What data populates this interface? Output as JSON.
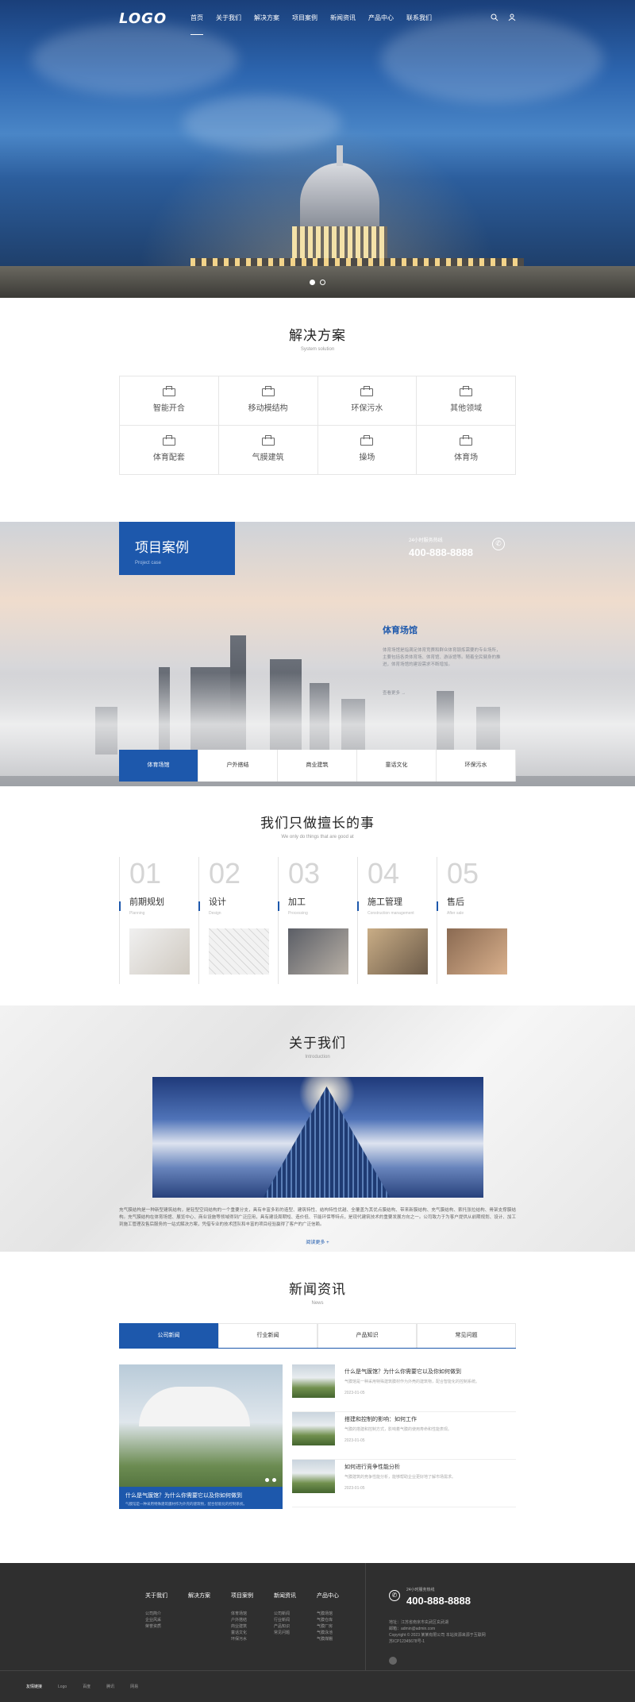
{
  "nav": {
    "logo": "LOGO",
    "items": [
      "首页",
      "关于我们",
      "解决方案",
      "项目案例",
      "新闻资讯",
      "产品中心",
      "联系我们"
    ],
    "icons": [
      "search-icon",
      "user-icon"
    ]
  },
  "solutions": {
    "title": "解决方案",
    "subtitle": "System solution",
    "items": [
      "智能开合",
      "移动模结构",
      "环保污水",
      "其他领域",
      "体育配套",
      "气膜建筑",
      "操场",
      "体育场"
    ]
  },
  "cases": {
    "badge_title": "项目案例",
    "badge_sub": "Project case",
    "hotline_label": "24小时服务热线",
    "hotline": "400-888-8888",
    "item_title": "体育场馆",
    "item_desc": "体育场馆是指满足体育竞赛和群众体育锻炼需要的专业场所，主要包括各类体育场、体育馆、游泳馆等。随着全民健身的推进，体育场馆的建设需求不断增加。",
    "item_more": "查看更多 →",
    "tabs": [
      "体育场馆",
      "户外搭结",
      "商业建筑",
      "童话文化",
      "环保污水"
    ]
  },
  "steps": {
    "title": "我们只做擅长的事",
    "subtitle": "We only do things that are good at",
    "items": [
      {
        "num": "01",
        "name": "前期规划",
        "en": "Planning"
      },
      {
        "num": "02",
        "name": "设计",
        "en": "Design"
      },
      {
        "num": "03",
        "name": "加工",
        "en": "Processing"
      },
      {
        "num": "04",
        "name": "施工管理",
        "en": "Construction management"
      },
      {
        "num": "05",
        "name": "售后",
        "en": "After sale"
      }
    ]
  },
  "about": {
    "title": "关于我们",
    "subtitle": "Introduction",
    "text": "充气膜结构是一种新型建筑结构，是轻型空间结构的一个重要分支，具有丰富多彩的造型、建筑特性、结构特性优越、全覆盖为其优点膜结构、带来新膜结构、充气膜结构、索托张拉结构、骨架支撑膜结构。充气膜结构在体育场馆、展览中心、商业设施等领域得到广泛应用，具有建设周期短、造价低、节能环保等特点，是现代建筑技术的重要发展方向之一。公司致力于为客户提供从前期规划、设计、加工到施工管理及售后服务的一站式解决方案，凭借专业的技术团队和丰富的项目经验赢得了客户的广泛信赖。",
    "more": "阅读更多 +"
  },
  "news": {
    "title": "新闻资讯",
    "subtitle": "News",
    "tabs": [
      "公司新闻",
      "行业新闻",
      "产品知识",
      "常见问题"
    ],
    "hero_title": "什么是气膜馆？为什么你需要它以及你如何做到",
    "hero_desc": "气膜馆是一种采用特殊建筑膜材作为外壳的建筑物，配合智能化的控制系统。",
    "items": [
      {
        "title": "什么是气膜馆？为什么你需要它以及你如何做到",
        "desc": "气膜馆是一种采用特殊建筑膜材作为外壳的建筑物，配合智能化的控制系统。",
        "date": "2023-01-05"
      },
      {
        "title": "搭建和控制的影响：如何工作",
        "desc": "气膜的搭建和控制方式，影响着气膜的使用寿命和性能表现。",
        "date": "2023-01-05"
      },
      {
        "title": "如何进行竞争性能分析",
        "desc": "气膜建筑的竞争性能分析，能够帮助企业更好地了解市场需求。",
        "date": "2023-01-05"
      }
    ]
  },
  "footer": {
    "cols": [
      {
        "head": "关于我们",
        "items": [
          "公司简介",
          "企业风采",
          "荣誉资质"
        ]
      },
      {
        "head": "解决方案",
        "items": []
      },
      {
        "head": "项目案例",
        "items": [
          "体育场馆",
          "户外搭结",
          "商业建筑",
          "童话文化",
          "环保污水"
        ]
      },
      {
        "head": "新闻资讯",
        "items": [
          "公司新闻",
          "行业新闻",
          "产品知识",
          "常见问题"
        ]
      },
      {
        "head": "产品中心",
        "items": [
          "气膜场馆",
          "气膜仓库",
          "气膜厂房",
          "气膜泳池",
          "气膜煤棚"
        ]
      }
    ],
    "phone_label": "24小时服务热线",
    "phone": "400-888-8888",
    "address": "地址：江苏省南京市玄武区玄武湖",
    "email": "邮箱：admin@admin.com",
    "copyright": "Copyright © 2023 某某有限公司 本站资源来源于互联网",
    "icp": "苏ICP12345678号-1",
    "links_label": "友情链接",
    "links": [
      "Logo",
      "百度",
      "腾讯",
      "网易"
    ]
  }
}
